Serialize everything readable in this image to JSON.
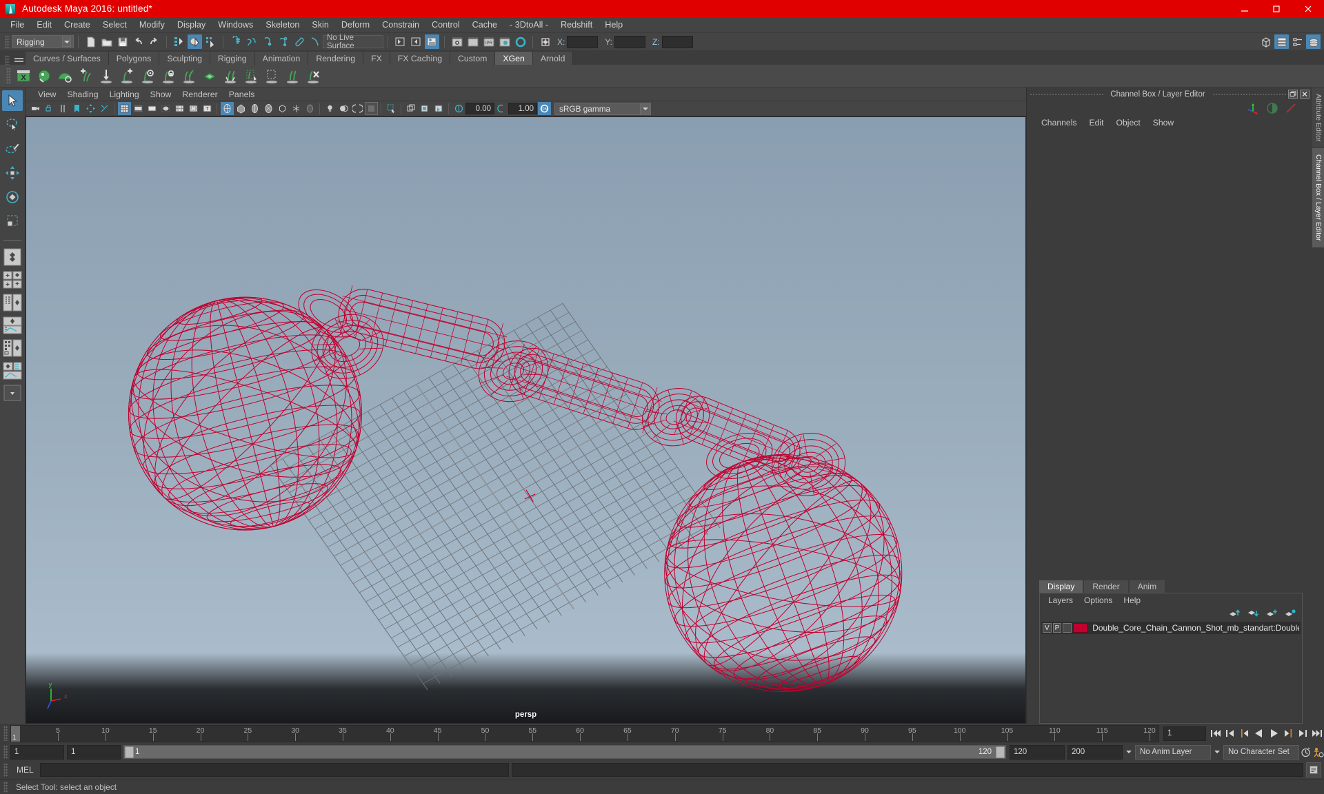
{
  "window": {
    "title": "Autodesk Maya 2016: untitled*",
    "logo_icon": "maya-logo-icon",
    "minimize_icon": "minimize-icon",
    "maximize_icon": "maximize-icon",
    "close_icon": "close-icon",
    "titlebar_color": "#e00000"
  },
  "menubar": {
    "items": [
      "File",
      "Edit",
      "Create",
      "Select",
      "Modify",
      "Display",
      "Windows",
      "Skeleton",
      "Skin",
      "Deform",
      "Constrain",
      "Control",
      "Cache",
      "- 3DtoAll -",
      "Redshift",
      "Help"
    ]
  },
  "statusline": {
    "menu_set": "Rigging",
    "live_surface": "No Live Surface",
    "coord_labels": {
      "x": "X:",
      "y": "Y:",
      "z": "Z:"
    },
    "coord_values": {
      "x": "",
      "y": "",
      "z": ""
    },
    "icons": [
      "new-scene-icon",
      "open-scene-icon",
      "save-scene-icon",
      "undo-icon",
      "redo-icon",
      "select-by-hierarchy-icon",
      "select-by-object-icon",
      "select-by-component-icon",
      "snap-to-grid-icon",
      "snap-to-curve-icon",
      "snap-to-point-icon",
      "snap-to-projected-center-icon",
      "snap-to-view-plane-icon",
      "make-live-icon",
      "show-hide-editors-icon",
      "show-hide-attribute-editor-icon",
      "show-hide-channel-box-icon",
      "render-current-frame-icon",
      "render-sequence-icon",
      "ipr-render-icon",
      "render-settings-icon",
      "hypershade-icon",
      "toggle-construction-history-icon"
    ],
    "right_icons": [
      "show-hide-modeling-toolkit-icon",
      "show-hide-attribute-editor-panel-icon",
      "show-hide-tool-settings-icon",
      "show-hide-channel-box-layer-editor-icon"
    ]
  },
  "shelf": {
    "tabs": [
      "Curves / Surfaces",
      "Polygons",
      "Sculpting",
      "Rigging",
      "Animation",
      "Rendering",
      "FX",
      "FX Caching",
      "Custom",
      "XGen",
      "Arnold"
    ],
    "active_tab": "XGen",
    "icons": [
      "xgen-editor-icon",
      "xgen-preview-icon",
      "xgen-description-icon",
      "xgen-add-guides-icon",
      "xgen-sculpt-guides-icon",
      "xgen-comb-icon",
      "xgen-noise-icon",
      "xgen-clumping-icon",
      "xgen-cut-icon",
      "xgen-density-icon",
      "xgen-region-map-icon",
      "xgen-mask-icon",
      "xgen-select-region-icon",
      "xgen-groom-icon",
      "xgen-delete-icon"
    ]
  },
  "toolbox": {
    "tools": [
      {
        "name": "select-tool",
        "selected": true
      },
      {
        "name": "lasso-select-tool",
        "selected": false
      },
      {
        "name": "paint-select-tool",
        "selected": false
      },
      {
        "name": "move-tool",
        "selected": false
      },
      {
        "name": "rotate-tool",
        "selected": false
      },
      {
        "name": "scale-tool",
        "selected": false
      }
    ],
    "layouts": [
      "single-perspective-layout",
      "four-view-layout",
      "outliner-persp-layout",
      "persp-graph-layout",
      "hypershade-persp-layout",
      "persp-graph-outliner-layout",
      "more-layouts"
    ]
  },
  "viewport": {
    "menu": [
      "View",
      "Shading",
      "Lighting",
      "Show",
      "Renderer",
      "Panels"
    ],
    "camera_label": "persp",
    "exposure_value": "0.00",
    "gamma_value": "1.00",
    "color_management": "sRGB gamma",
    "axis_gizmo": {
      "x": "x",
      "y": "y",
      "z": "z"
    },
    "background_top": "#8fa3b5",
    "background_bottom": "#9fb2c2",
    "wireframe_color": "#c2002f",
    "grid_color": "#6e7378",
    "toolbar_icons": [
      "select-camera-icon",
      "lock-camera-icon",
      "camera-attributes-icon",
      "bookmark-icon",
      "image-plane-icon",
      "2d-pan-zoom-icon",
      "grid-icon",
      "film-gate-icon",
      "resolution-gate-icon",
      "gate-mask-icon",
      "field-chart-icon",
      "safe-action-icon",
      "safe-title-icon",
      "wireframe-icon",
      "smooth-shade-all-icon",
      "smooth-shade-selected-icon",
      "flat-shade-icon",
      "bounding-box-icon",
      "wireframe-on-shaded-icon",
      "xray-icon",
      "xray-joints-icon",
      "xray-active-components-icon",
      "use-default-lighting-icon",
      "use-all-lights-icon",
      "shadows-icon",
      "screen-space-ao-icon",
      "motion-blur-icon",
      "multisample-icon",
      "isolate-select-icon",
      "exposure-icon",
      "gamma-icon",
      "color-management-icon"
    ]
  },
  "channel_box_panel": {
    "title": "Channel Box / Layer Editor",
    "restore_icon": "restore-panel-icon",
    "close_icon": "close-panel-icon",
    "menu": [
      "Channels",
      "Edit",
      "Object",
      "Show"
    ],
    "tool_icons": [
      "manipulator-icon",
      "half-circle-icon",
      "slash-icon"
    ]
  },
  "layer_editor": {
    "tabs": [
      "Display",
      "Render",
      "Anim"
    ],
    "active_tab": "Display",
    "menu": [
      "Layers",
      "Options",
      "Help"
    ],
    "icons": [
      "move-layer-up-icon",
      "move-layer-down-icon",
      "new-layer-icon",
      "new-layer-from-selected-icon"
    ],
    "layers": [
      {
        "visibility": "V",
        "playback": "P",
        "shading": "",
        "color": "#c2002f",
        "name": "Double_Core_Chain_Cannon_Shot_mb_standart:Double_"
      }
    ]
  },
  "vertical_tabs": {
    "items": [
      "Attribute Editor",
      "Channel Box / Layer Editor"
    ],
    "active": "Channel Box / Layer Editor"
  },
  "timeline": {
    "current_frame": "1",
    "ticks": [
      5,
      10,
      15,
      20,
      25,
      30,
      35,
      40,
      45,
      50,
      55,
      60,
      65,
      70,
      75,
      80,
      85,
      90,
      95,
      100,
      105,
      110,
      115,
      120
    ],
    "start": 1,
    "end": 120,
    "frame_field": "1",
    "playback_icons": [
      "go-to-start-icon",
      "step-back-key-icon",
      "step-back-frame-icon",
      "play-backwards-icon",
      "play-forwards-icon",
      "step-forward-frame-icon",
      "step-forward-key-icon",
      "go-to-end-icon"
    ]
  },
  "range_slider": {
    "anim_start": "1",
    "anim_end": "1",
    "range_start": "1",
    "range_end": "120",
    "playback_end": "120",
    "anim_end_total": "200",
    "anim_layer": "No Anim Layer",
    "character_set": "No Character Set",
    "auto_key_icon": "auto-keyframe-icon",
    "anim_prefs_icon": "animation-preferences-icon"
  },
  "command_line": {
    "language_label": "MEL",
    "input_value": "",
    "output_value": "",
    "script_editor_icon": "script-editor-icon"
  },
  "help_line": {
    "text": "Select Tool: select an object"
  }
}
